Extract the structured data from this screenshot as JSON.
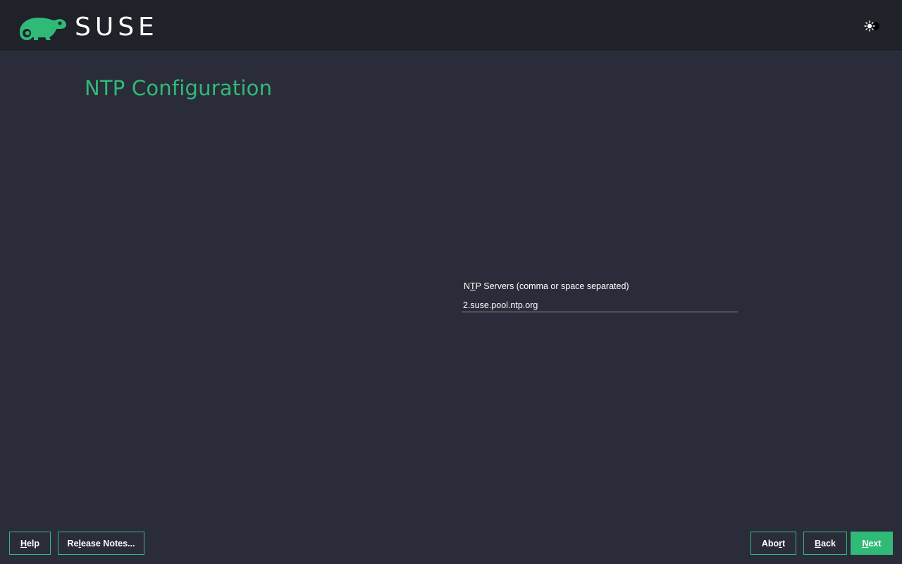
{
  "header": {
    "brand": "SUSE",
    "theme_toggle_icon": "sun-toggle-icon"
  },
  "page": {
    "title": "NTP Configuration"
  },
  "ntp_field": {
    "label_pre": "N",
    "label_key": "T",
    "label_post": "P Servers (comma or space separated)",
    "value": "2.suse.pool.ntp.org"
  },
  "buttons": {
    "help": {
      "key": "H",
      "rest": "elp"
    },
    "release_notes": {
      "pre": "Re",
      "key": "l",
      "post": "ease Notes..."
    },
    "abort": {
      "pre": "Abo",
      "key": "r",
      "post": "t"
    },
    "back": {
      "key": "B",
      "rest": "ack"
    },
    "next": {
      "key": "N",
      "rest": "ext"
    }
  },
  "colors": {
    "accent": "#30ba78",
    "background": "#2a2d39",
    "topbar": "#1f2228"
  }
}
